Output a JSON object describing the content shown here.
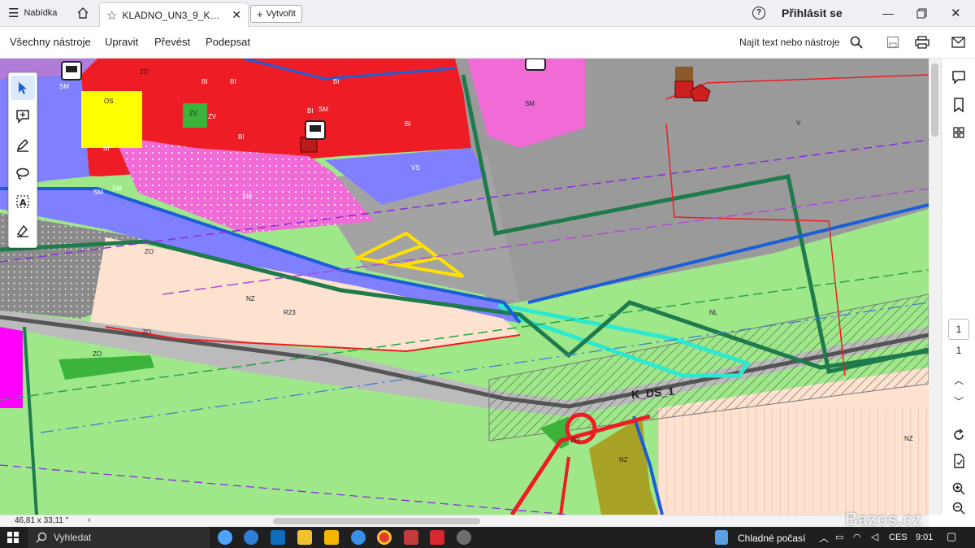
{
  "tabbar": {
    "menu_label": "Nabídka",
    "tab_title": "KLADNO_UN3_9_K…",
    "create_label": "Vytvořit",
    "help_label": "?",
    "signin_label": "Přihlásit se"
  },
  "menubar": {
    "items": [
      "Všechny nástroje",
      "Upravit",
      "Převést",
      "Podepsat"
    ],
    "search_label": "Najít text nebo nástroje"
  },
  "map": {
    "labels": {
      "os": "OS",
      "sm1": "SM",
      "sm2": "SM",
      "sm3": "SM",
      "sm4": "SM",
      "sm5": "SM",
      "sm6": "SM",
      "bi1": "BI",
      "bi2": "BI",
      "bi3": "BI",
      "bi4": "BI",
      "bi5": "BI",
      "bi6": "BI",
      "bi7": "BI",
      "zv1": "ZV",
      "zv2": "ZV",
      "vs": "VS",
      "v": "V",
      "zo1": "ZO",
      "zo2": "ZO",
      "zo3": "ZO",
      "zo4": "ZO",
      "zo5": "ZO",
      "nz1": "NZ",
      "nz2": "NZ",
      "nz3": "NZ",
      "nl": "NL",
      "r23": "R23",
      "kds": "K_DS_1"
    }
  },
  "rail": {
    "page_current": "1",
    "page_total": "1"
  },
  "status": {
    "dimensions": "46,81 x 33,11 \""
  },
  "taskbar": {
    "search_label": "Vyhledat",
    "weather": "Chladné počasí",
    "lang": "CES",
    "time": "9:01",
    "watermark": "Bazos.cz"
  },
  "colors": {
    "residential_red": "#ee1c24",
    "mixed_pink": "#f06bd6",
    "transport_gray": "#9a9a9a",
    "agri_green": "#9ee88a",
    "periwinkle": "#8080ff",
    "peach": "#fde3cf",
    "yellow_os": "#ffff00",
    "corridor_cyan": "#2ee8d0"
  }
}
